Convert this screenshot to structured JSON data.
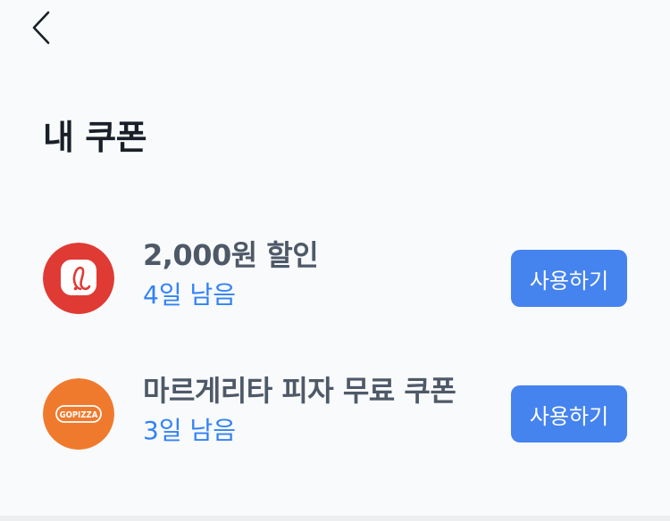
{
  "header": {
    "back_icon": "chevron-left-icon"
  },
  "page_title": "내 쿠폰",
  "colors": {
    "accent": "#4583ee",
    "remaining_text": "#3182f6",
    "title_text": "#191f28",
    "coupon_title_text": "#4e5968",
    "background": "#f9fafb"
  },
  "coupons": [
    {
      "title": "2,000원 할인",
      "remaining": "4일 남음",
      "button_label": "사용하기",
      "logo_icon": "l-brand-logo-icon",
      "logo_color": "#e03a34"
    },
    {
      "title": "마르게리타 피자 무료 쿠폰",
      "remaining": "3일 남음",
      "button_label": "사용하기",
      "logo_icon": "gopizza-logo-icon",
      "logo_text": "GOPIZZA",
      "logo_color": "#ef7a2e"
    }
  ]
}
